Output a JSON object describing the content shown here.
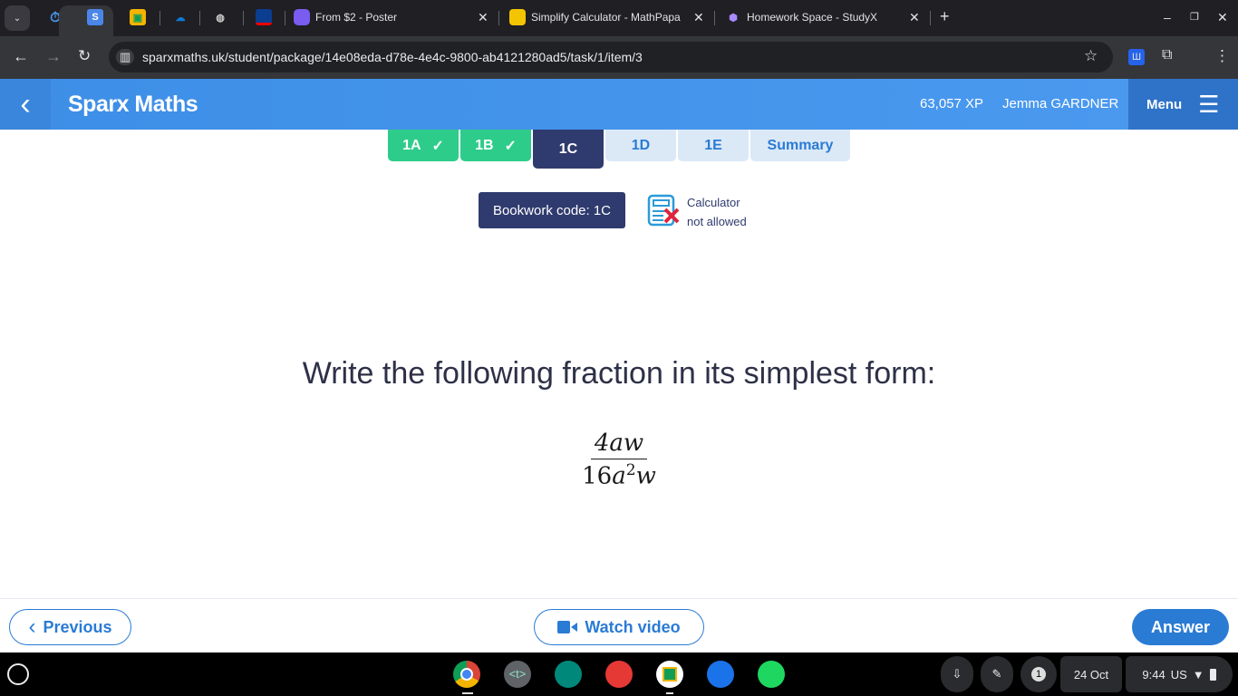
{
  "browser": {
    "tabs": [
      {
        "title": "From $2 - Poster",
        "icon": "printer-icon"
      },
      {
        "title": "Simplify Calculator - MathPapa",
        "icon": "mathpapa-icon"
      },
      {
        "title": "Homework Space - StudyX",
        "icon": "studyx-icon"
      }
    ],
    "url": "sparxmaths.uk/student/package/14e08eda-d78e-4e4c-9800-ab4121280ad5/task/1/item/3"
  },
  "header": {
    "brand": "Sparx Maths",
    "xp": "63,057 XP",
    "user": "Jemma GARDNER",
    "menu_label": "Menu"
  },
  "task_tabs": [
    {
      "label": "1A",
      "state": "complete"
    },
    {
      "label": "1B",
      "state": "complete"
    },
    {
      "label": "1C",
      "state": "current"
    },
    {
      "label": "1D",
      "state": "todo"
    },
    {
      "label": "1E",
      "state": "todo"
    },
    {
      "label": "Summary",
      "state": "todo"
    }
  ],
  "bookwork": "Bookwork code: 1C",
  "calculator": {
    "line1": "Calculator",
    "line2": "not allowed"
  },
  "question": {
    "text": "Write the following fraction in its simplest form:",
    "numerator": "4aw",
    "den_coef": "16",
    "den_a": "a",
    "den_exp": "2",
    "den_w": "w"
  },
  "footer": {
    "previous": "Previous",
    "watch": "Watch video",
    "answer": "Answer"
  },
  "taskbar": {
    "notifications": "1",
    "date": "24 Oct",
    "time": "9:44",
    "locale": "US"
  },
  "colors": {
    "accent": "#2a7bd4",
    "complete": "#2ecc8a",
    "current": "#2f3b6e"
  }
}
